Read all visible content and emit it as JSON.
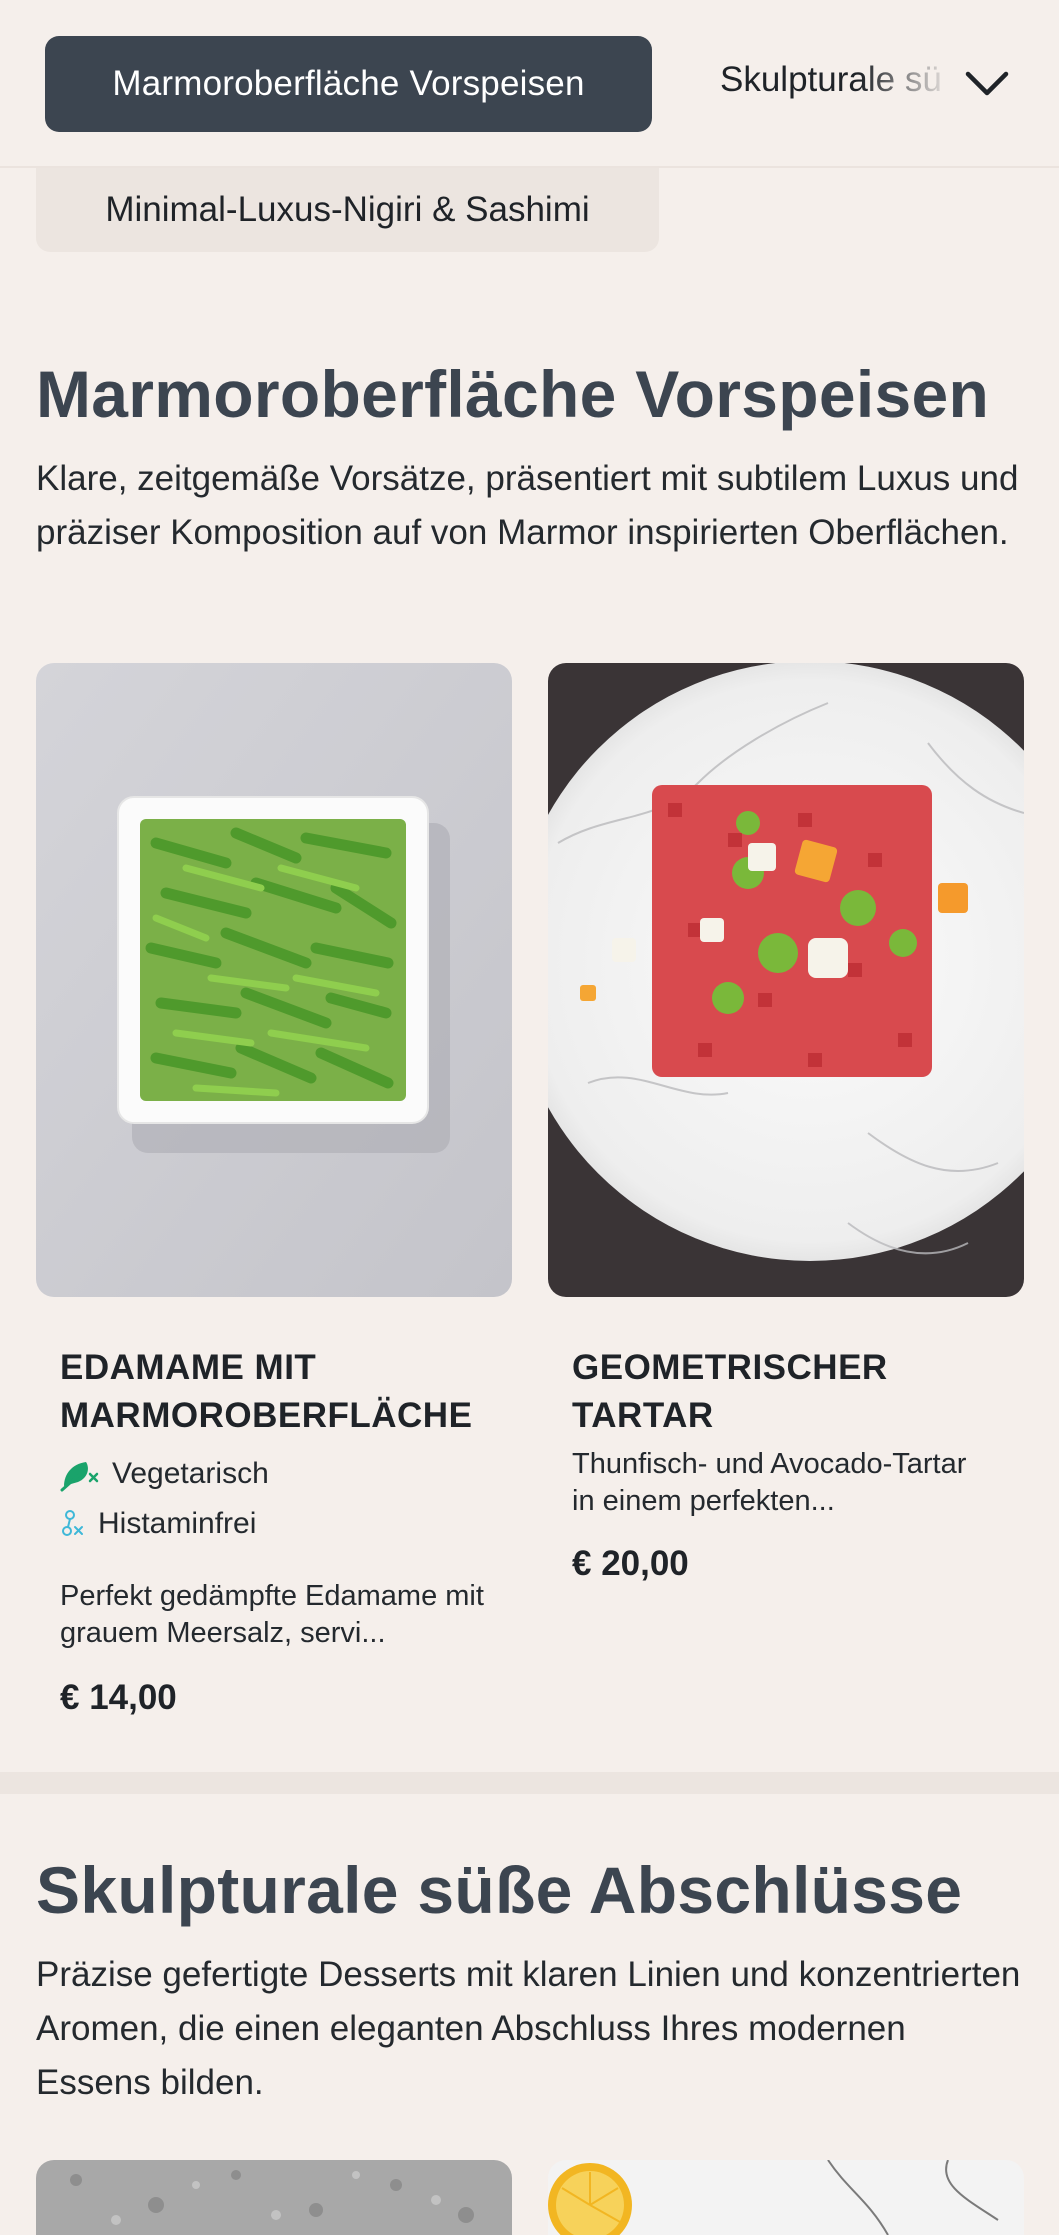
{
  "category_nav": {
    "active": "Marmoroberfläche Vorspeisen",
    "next": "Skulpturale süße Abschlüsse",
    "previous": "Minimal-Luxus-Nigiri & Sashimi",
    "dropdown_icon": "chevron-down-icon"
  },
  "sections": [
    {
      "title": "Marmoroberfläche Vorspeisen",
      "description": "Klare, zeitgemäße Vorsätze, präsentiert mit subtilem Luxus und präziser Komposition auf von Marmor inspirierten Oberflächen.",
      "items": [
        {
          "name": "EDAMAME MIT MARMOROBERFLÄCHE",
          "tags": [
            {
              "label": "Vegetarisch",
              "icon": "vegetarian-icon",
              "color": "#1aa36b"
            },
            {
              "label": "Histaminfrei",
              "icon": "histamine-free-icon",
              "color": "#3fb8d8"
            }
          ],
          "description": "Perfekt gedämpfte Edamame mit grauem Meersalz, servi...",
          "price": "€ 14,00"
        },
        {
          "name": "GEOMETRISCHER TARTAR",
          "tags": [],
          "description": "Thunfisch- und Avocado-Tartar in einem perfekten...",
          "price": "€ 20,00"
        }
      ]
    },
    {
      "title": "Skulpturale süße Abschlüsse",
      "description": "Präzise gefertigte Desserts mit klaren Linien und konzentrierten Aromen, die einen eleganten Abschluss Ihres modernen Essens bilden.",
      "items": []
    }
  ],
  "colors": {
    "background": "#f5efeb",
    "active_pill": "#3c4550",
    "heading": "#3c4550"
  }
}
